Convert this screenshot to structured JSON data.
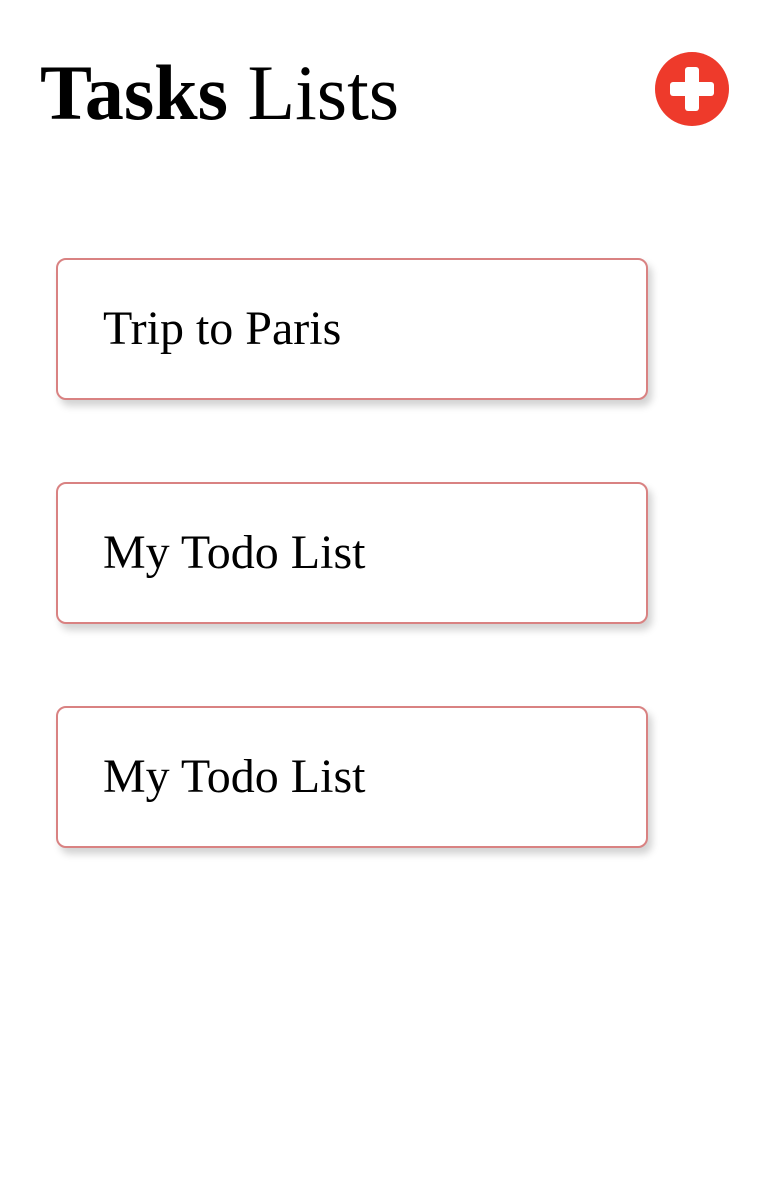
{
  "header": {
    "title_bold": "Tasks",
    "title_regular": "Lists",
    "add_button": {
      "icon": "plus-circle-icon",
      "color": "#ee3a2b"
    }
  },
  "lists": [
    {
      "label": "Trip to Paris"
    },
    {
      "label": "My Todo List"
    },
    {
      "label": "My Todo List"
    }
  ],
  "colors": {
    "card_border": "#d98282",
    "background": "#ffffff",
    "text": "#000000"
  }
}
